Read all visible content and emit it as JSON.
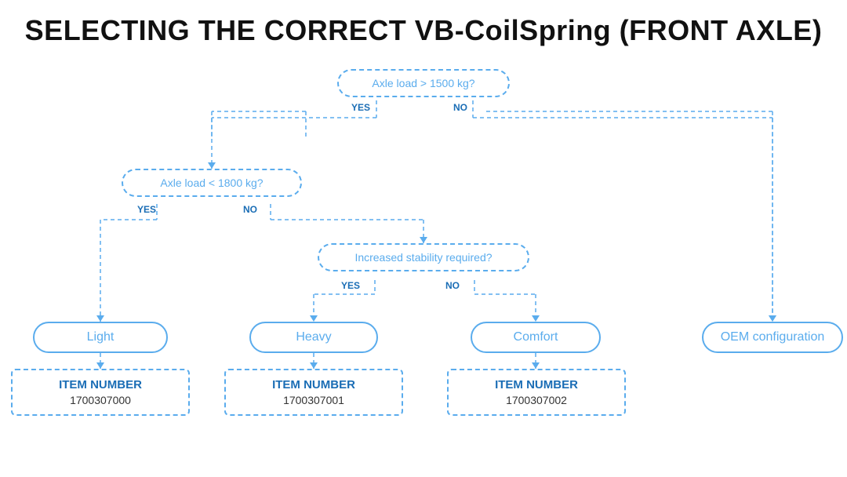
{
  "title": "SELECTING THE CORRECT VB-CoilSpring (FRONT AXLE)",
  "decision1": {
    "text": "Axle load > 1500 kg?",
    "yes": "YES",
    "no": "NO"
  },
  "decision2": {
    "text": "Axle load < 1800 kg?",
    "yes": "YES",
    "no": "NO"
  },
  "decision3": {
    "text": "Increased stability required?",
    "yes": "YES",
    "no": "NO"
  },
  "results": {
    "light": "Light",
    "heavy": "Heavy",
    "comfort": "Comfort",
    "oem": "OEM configuration"
  },
  "items": {
    "item0": {
      "label": "ITEM NUMBER",
      "number": "1700307000"
    },
    "item1": {
      "label": "ITEM NUMBER",
      "number": "1700307001"
    },
    "item2": {
      "label": "ITEM NUMBER",
      "number": "1700307002"
    }
  },
  "colors": {
    "accent": "#5aaced",
    "dark_accent": "#1a6db5",
    "text": "#111111"
  }
}
